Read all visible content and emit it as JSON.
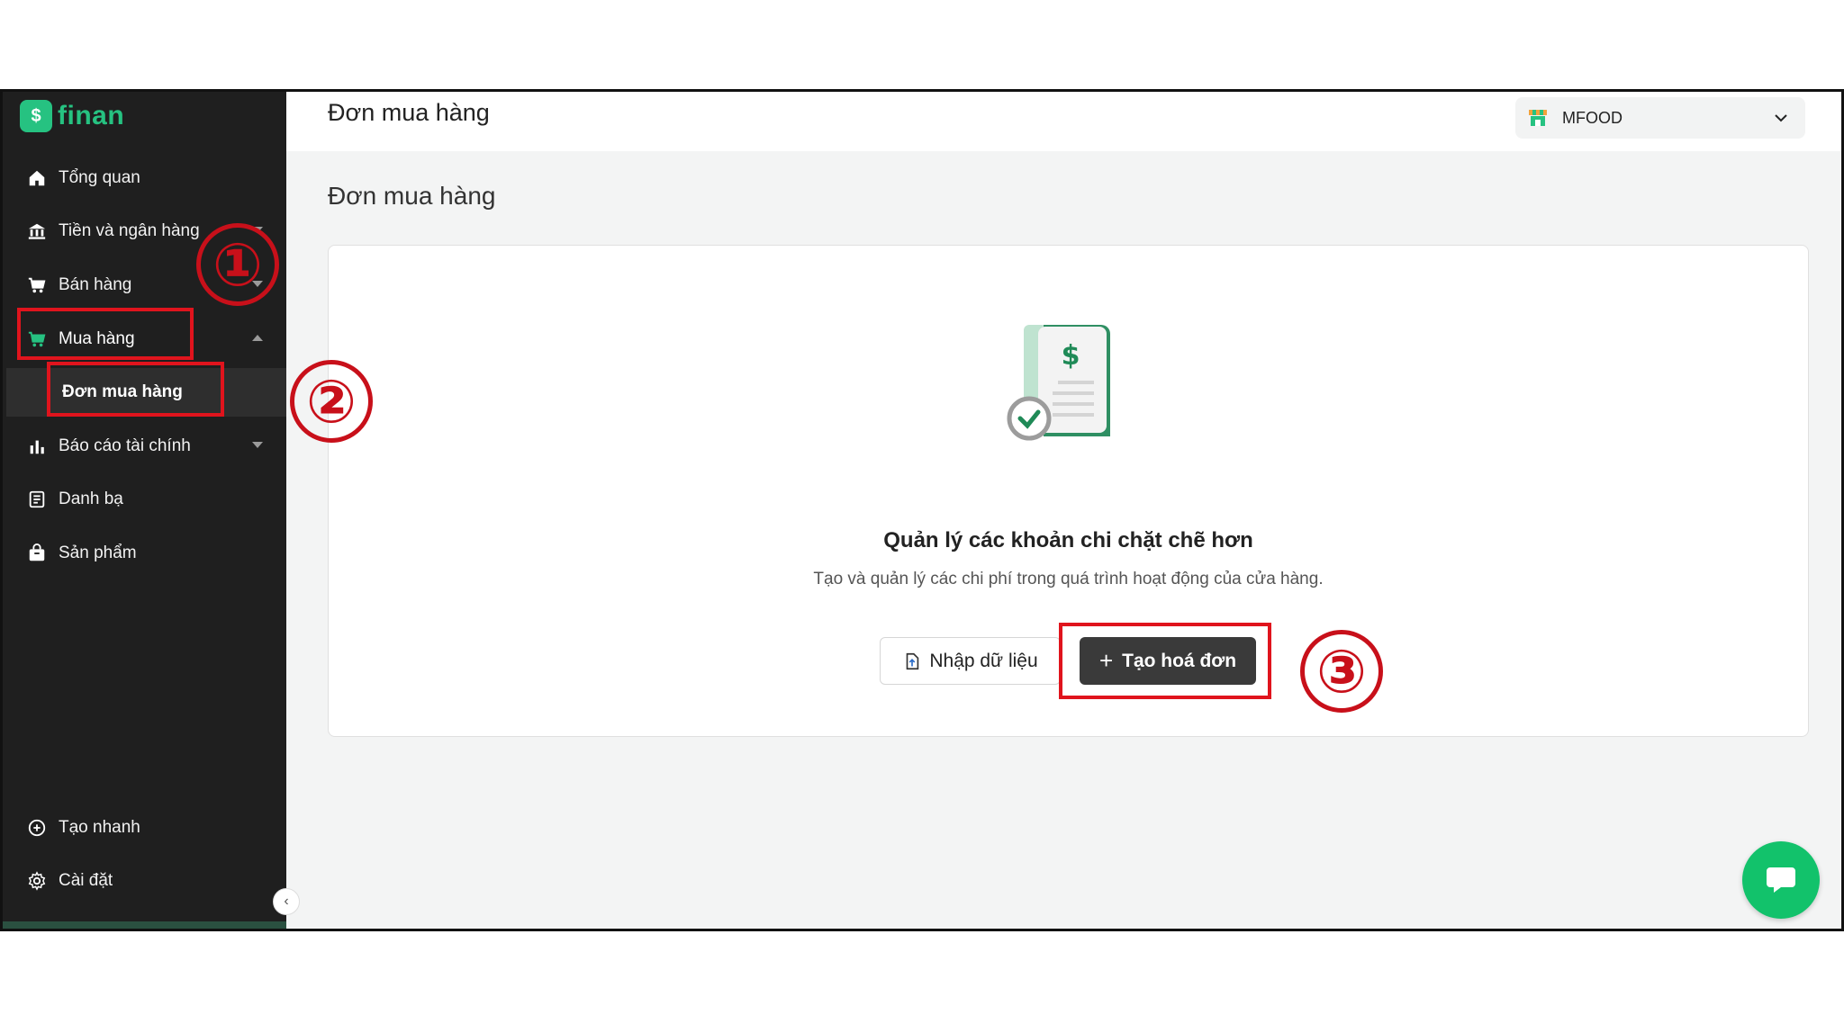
{
  "app": {
    "logo_text": "finan",
    "logo_symbol": "$"
  },
  "sidebar": {
    "items": [
      {
        "label": "Tổng quan",
        "icon": "home-icon"
      },
      {
        "label": "Tiền và ngân hàng",
        "icon": "bank-icon"
      },
      {
        "label": "Bán hàng",
        "icon": "cart-icon"
      },
      {
        "label": "Mua hàng",
        "icon": "purchase-cart-icon"
      },
      {
        "label": "Báo cáo tài chính",
        "icon": "bar-chart-icon"
      },
      {
        "label": "Danh bạ",
        "icon": "contacts-icon"
      },
      {
        "label": "Sản phẩm",
        "icon": "product-box-icon"
      }
    ],
    "sub_item": {
      "label": "Đơn mua hàng"
    },
    "bottom_items": [
      {
        "label": "Tạo nhanh",
        "icon": "plus-circle-icon"
      },
      {
        "label": "Cài đặt",
        "icon": "gear-icon"
      }
    ]
  },
  "header": {
    "title": "Đơn mua hàng",
    "store": {
      "name": "MFOOD",
      "icon": "store-icon"
    }
  },
  "main": {
    "page_title": "Đơn mua hàng",
    "empty_state": {
      "title": "Quản lý các khoản chi chặt chẽ hơn",
      "subtitle": "Tạo và quản lý các chi phí trong quá trình hoạt động của cửa hàng.",
      "import_button": "Nhập dữ liệu",
      "create_button": "Tạo hoá đơn",
      "create_plus": "+"
    }
  },
  "annotations": [
    "①",
    "②",
    "③"
  ],
  "colors": {
    "brand_green": "#26c281",
    "sidebar_bg": "#1f1f1f",
    "highlight_red": "#e0141d",
    "chat_green": "#12c26b",
    "button_dark": "#3a3a3a"
  }
}
